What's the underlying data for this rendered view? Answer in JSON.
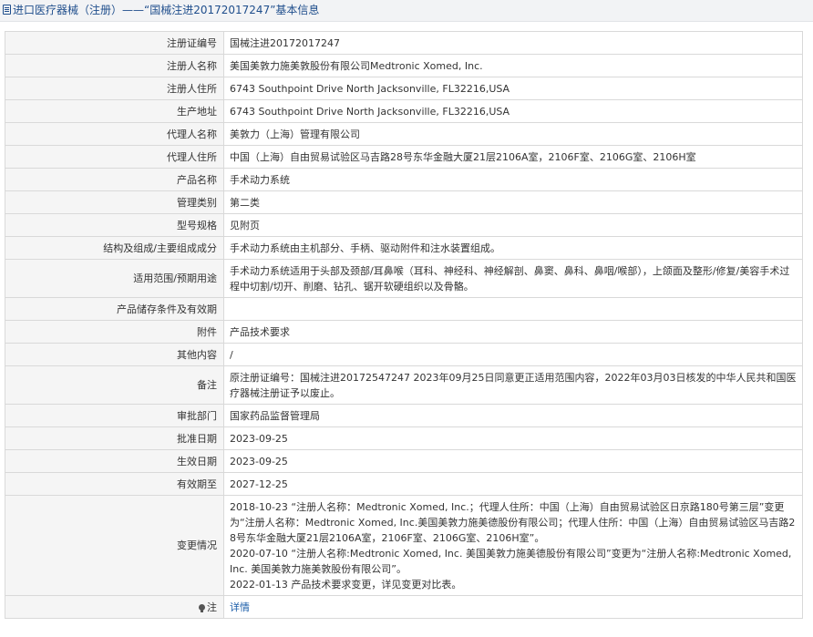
{
  "header": {
    "title": "进口医疗器械（注册）——“国械注进20172017247”基本信息"
  },
  "rows": {
    "reg_no": {
      "label": "注册证编号",
      "value": "国械注进20172017247"
    },
    "registrant_name": {
      "label": "注册人名称",
      "value": "美国美敦力施美敦股份有限公司Medtronic Xomed, Inc."
    },
    "registrant_address": {
      "label": "注册人住所",
      "value": "6743 Southpoint Drive North Jacksonville, FL32216,USA"
    },
    "production_address": {
      "label": "生产地址",
      "value": "6743 Southpoint Drive North Jacksonville, FL32216,USA"
    },
    "agent_name": {
      "label": "代理人名称",
      "value": "美敦力（上海）管理有限公司"
    },
    "agent_address": {
      "label": "代理人住所",
      "value": "中国（上海）自由贸易试验区马吉路28号东华金融大厦21层2106A室，2106F室、2106G室、2106H室"
    },
    "product_name": {
      "label": "产品名称",
      "value": "手术动力系统"
    },
    "management_class": {
      "label": "管理类别",
      "value": "第二类"
    },
    "model_spec": {
      "label": "型号规格",
      "value": "见附页"
    },
    "structure": {
      "label": "结构及组成/主要组成成分",
      "value": "手术动力系统由主机部分、手柄、驱动附件和注水装置组成。"
    },
    "scope": {
      "label": "适用范围/预期用途",
      "value": "手术动力系统适用于头部及颈部/耳鼻喉（耳科、神经科、神经解剖、鼻窦、鼻科、鼻咽/喉部），上颌面及整形/修复/美容手术过程中切割/切开、削磨、钻孔、锯开软硬组织以及骨骼。"
    },
    "storage": {
      "label": "产品储存条件及有效期",
      "value": ""
    },
    "attachment": {
      "label": "附件",
      "value": "产品技术要求"
    },
    "other": {
      "label": "其他内容",
      "value": "/"
    },
    "remark": {
      "label": "备注",
      "value": "原注册证编号：国械注进20172547247 2023年09月25日同意更正适用范围内容，2022年03月03日核发的中华人民共和国医疗器械注册证予以废止。"
    },
    "approval_dept": {
      "label": "审批部门",
      "value": "国家药品监督管理局"
    },
    "approval_date": {
      "label": "批准日期",
      "value": "2023-09-25"
    },
    "effective_date": {
      "label": "生效日期",
      "value": "2023-09-25"
    },
    "expiry_date": {
      "label": "有效期至",
      "value": "2027-12-25"
    },
    "change_history": {
      "label": "变更情况",
      "lines": [
        "2018-10-23 “注册人名称：Medtronic Xomed, Inc.；代理人住所：中国（上海）自由贸易试验区日京路180号第三层”变更为“注册人名称：Medtronic Xomed, Inc.美国美敦力施美德股份有限公司；代理人住所：中国（上海）自由贸易试验区马吉路28号东华金融大厦21层2106A室，2106F室、2106G室、2106H室”。",
        "2020-07-10 “注册人名称:Medtronic Xomed, Inc. 美国美敦力施美德股份有限公司”变更为“注册人名称:Medtronic Xomed, Inc. 美国美敦力施美敦股份有限公司”。",
        "2022-01-13 产品技术要求变更，详见变更对比表。"
      ]
    },
    "note": {
      "label": "注",
      "link_text": "详情",
      "icon": "tip-icon"
    }
  }
}
